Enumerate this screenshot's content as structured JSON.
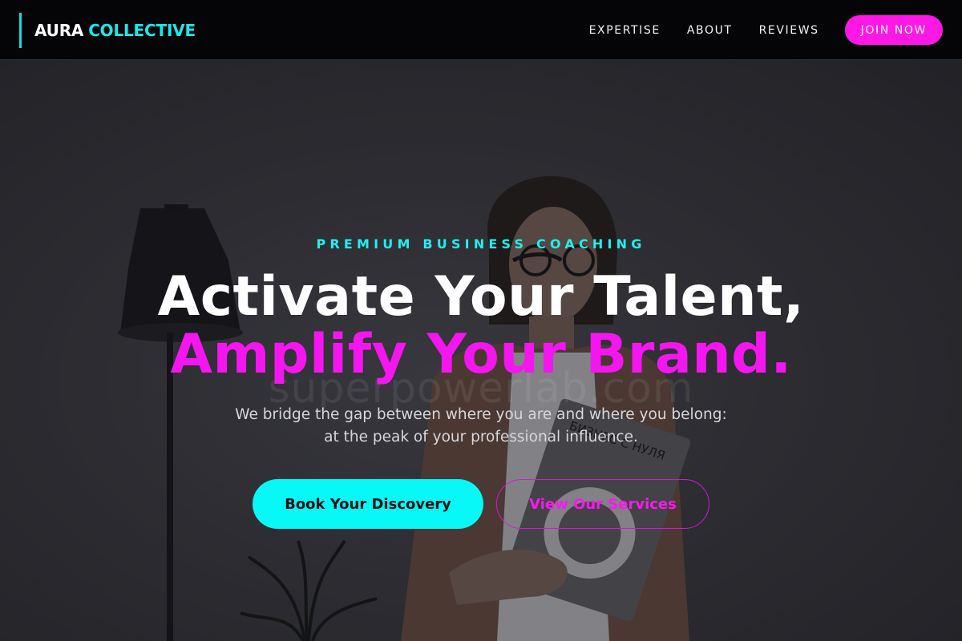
{
  "nav": {
    "brand_part1": "AURA",
    "brand_part2": "COLLECTIVE",
    "links": [
      "EXPERTISE",
      "ABOUT",
      "REVIEWS"
    ],
    "cta": "JOIN NOW"
  },
  "hero": {
    "eyebrow": "PREMIUM BUSINESS COACHING",
    "headline_line1": "Activate Your Talent,",
    "headline_line2": "Amplify Your Brand.",
    "watermark": "superpowerlab.com",
    "subtitle_line1": "We bridge the gap between where you are and where you belong:",
    "subtitle_line2": "at the peak of your professional influence.",
    "primary_cta": "Book Your Discovery",
    "secondary_cta": "View Our Services",
    "book_cover_text": "БИЗНЕС С НУЛЯ"
  },
  "colors": {
    "nav_bg": "#050507",
    "accent_cyan": "#08f8f8",
    "accent_magenta": "#ff17e6",
    "text_white": "#ffffff",
    "subtitle_gray": "#d7d7da"
  }
}
